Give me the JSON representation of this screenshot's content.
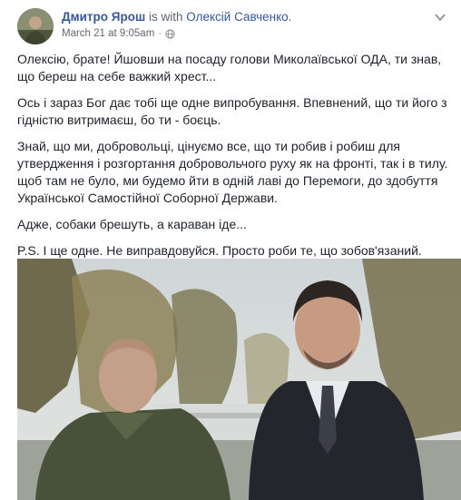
{
  "post": {
    "author": "Дмитро Ярош",
    "with_text": "is with",
    "tagged": "Олексій Савченко.",
    "timestamp": "March 21 at 9:05am",
    "separator": "·",
    "audience_icon": "globe-icon",
    "menu_icon": "chevron-down-icon",
    "paragraphs": [
      "Олексію, брате! Йшовши на посаду голови Миколаївської ОДА, ти знав,\nщо береш на себе важкий хрест...",
      "Ось і зараз Бог дає тобі ще одне випробування. Впевнений, що ти його з\nгідністю витримаєш, бо ти - боєць.",
      "Знай, що ми, добровольці, цінуємо все, що ти робив і робиш для\nутвердження і розгортання добровольчого руху як на фронті, так і в тилу.\nщоб там не було, ми будемо йти в одній лаві до Перемоги, до здобуття\nУкраїнської Самостійної Соборної Держави.",
      "Адже, собаки брешуть, а караван іде...",
      "P.S. І ще одне. Не виправдовуйся. Просто роби те, що зобов'язаний."
    ]
  },
  "colors": {
    "link": "#365899",
    "meta": "#616770",
    "text": "#1d2129"
  }
}
